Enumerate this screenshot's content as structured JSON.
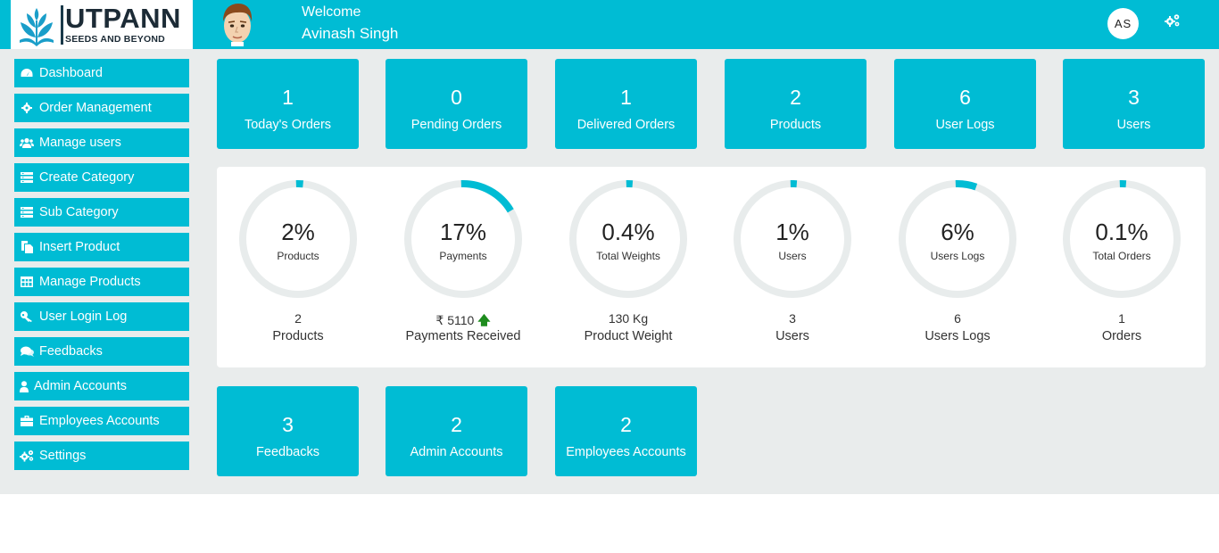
{
  "header": {
    "brand_name": "UTPANN",
    "brand_tagline": "SEEDS AND BEYOND",
    "welcome_label": "Welcome",
    "user_name": "Avinash Singh",
    "user_initials": "AS",
    "accent_color": "#00bcd4"
  },
  "sidebar": {
    "items": [
      {
        "label": "Dashboard",
        "icon": "dashboard-icon"
      },
      {
        "label": "Order Management",
        "icon": "gear-icon"
      },
      {
        "label": "Manage users",
        "icon": "users-icon"
      },
      {
        "label": "Create Category",
        "icon": "list-icon"
      },
      {
        "label": "Sub Category",
        "icon": "list-icon"
      },
      {
        "label": "Insert Product",
        "icon": "copy-icon"
      },
      {
        "label": "Manage Products",
        "icon": "table-icon"
      },
      {
        "label": "User Login Log",
        "icon": "key-icon"
      },
      {
        "label": "Feedbacks",
        "icon": "comments-icon"
      },
      {
        "label": "Admin Accounts",
        "icon": "user-icon"
      },
      {
        "label": "Employees Accounts",
        "icon": "briefcase-icon"
      },
      {
        "label": "Settings",
        "icon": "gears-icon"
      }
    ]
  },
  "tiles_top": [
    {
      "value": "1",
      "label": "Today's Orders"
    },
    {
      "value": "0",
      "label": "Pending Orders"
    },
    {
      "value": "1",
      "label": "Delivered Orders"
    },
    {
      "value": "2",
      "label": "Products"
    },
    {
      "value": "6",
      "label": "User Logs"
    },
    {
      "value": "3",
      "label": "Users"
    }
  ],
  "gauges": [
    {
      "percent_text": "2%",
      "percent": 2,
      "label": "Products",
      "value": "2",
      "caption": "Products"
    },
    {
      "percent_text": "17%",
      "percent": 17,
      "label": "Payments",
      "value": "₹ 5110",
      "value_suffix": "🡅",
      "caption": "Payments Received"
    },
    {
      "percent_text": "0.4%",
      "percent": 0.4,
      "label": "Total Weights",
      "value": "130 Kg",
      "caption": "Product Weight"
    },
    {
      "percent_text": "1%",
      "percent": 1,
      "label": "Users",
      "value": "3",
      "caption": "Users"
    },
    {
      "percent_text": "6%",
      "percent": 6,
      "label": "Users Logs",
      "value": "6",
      "caption": "Users Logs"
    },
    {
      "percent_text": "0.1%",
      "percent": 0.1,
      "label": "Total Orders",
      "value": "1",
      "caption": "Orders"
    }
  ],
  "tiles_bottom": [
    {
      "value": "3",
      "label": "Feedbacks"
    },
    {
      "value": "2",
      "label": "Admin Accounts"
    },
    {
      "value": "2",
      "label": "Employees Accounts"
    }
  ],
  "colors": {
    "accent": "#00bcd4",
    "ring_track": "#e8ecec",
    "arrow": "#1e8c1e"
  }
}
